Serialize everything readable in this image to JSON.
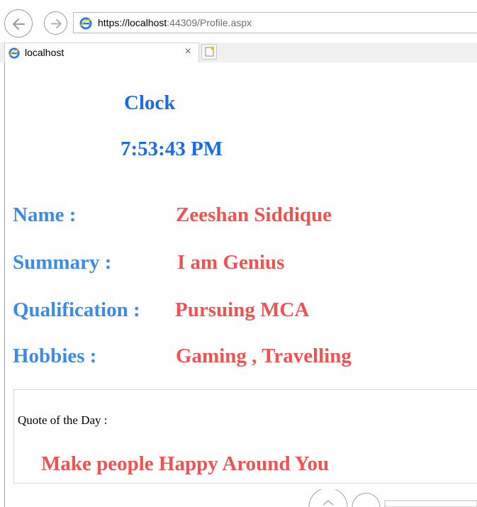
{
  "browser": {
    "url_host": "https://localhost",
    "url_port": ":44309",
    "url_path": "/Profile.aspx",
    "tab_title": "localhost",
    "tab_close": "×"
  },
  "clock": {
    "title": "Clock",
    "time": "7:53:43 PM"
  },
  "profile": [
    {
      "label": "Name :",
      "value": "Zeeshan Siddique"
    },
    {
      "label": "Summary :",
      "value": "I am Genius"
    },
    {
      "label": "Qualification :",
      "value": "Pursuing MCA"
    },
    {
      "label": "Hobbies :",
      "value": "Gaming , Travelling"
    }
  ],
  "quote": {
    "label": "Quote of the Day :",
    "text": "Make people Happy Around You"
  },
  "colors": {
    "clock_blue": "#1a6be6",
    "label_blue": "#3a8ae8",
    "value_red": "#f05252"
  }
}
